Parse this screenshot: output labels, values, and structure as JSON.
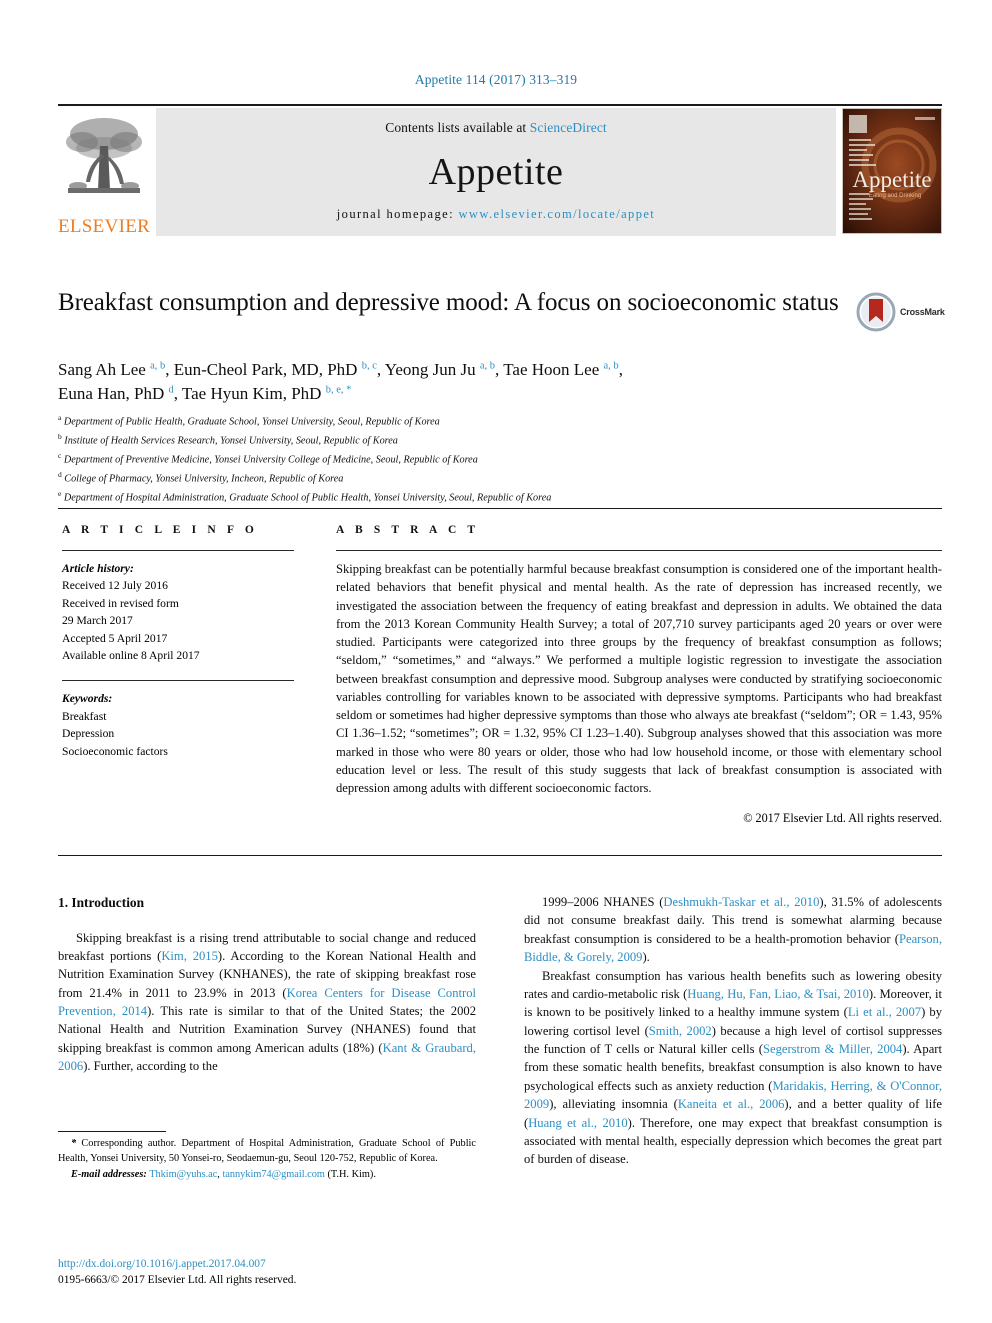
{
  "running_head": "Appetite 114 (2017) 313–319",
  "banner": {
    "publisher": "ELSEVIER",
    "contents_prefix": "Contents lists available at ",
    "contents_link": "ScienceDirect",
    "journal_name": "Appetite",
    "homepage_prefix": "journal homepage: ",
    "homepage_url": "www.elsevier.com/locate/appet",
    "cover_title": "Appetite",
    "cover_subtitle": "Eating and Drinking"
  },
  "article": {
    "title": "Breakfast consumption and depressive mood: A focus on socioeconomic status",
    "crossmark_label": "CrossMark",
    "authors_line1": "Sang Ah Lee <sup>a, b</sup>, Eun-Cheol Park, MD, PhD <sup>b, c</sup>, Yeong Jun Ju <sup>a, b</sup>, Tae Hoon Lee <sup>a, b</sup>,",
    "authors_line2": "Euna Han, PhD <sup>d</sup>, Tae Hyun Kim, PhD <sup>b, e, *</sup>",
    "affiliations": [
      {
        "marker": "a",
        "text": "Department of Public Health, Graduate School, Yonsei University, Seoul, Republic of Korea"
      },
      {
        "marker": "b",
        "text": "Institute of Health Services Research, Yonsei University, Seoul, Republic of Korea"
      },
      {
        "marker": "c",
        "text": "Department of Preventive Medicine, Yonsei University College of Medicine, Seoul, Republic of Korea"
      },
      {
        "marker": "d",
        "text": "College of Pharmacy, Yonsei University, Incheon, Republic of Korea"
      },
      {
        "marker": "e",
        "text": "Department of Hospital Administration, Graduate School of Public Health, Yonsei University, Seoul, Republic of Korea"
      }
    ]
  },
  "article_info": {
    "heading": "A R T I C L E  I N F O",
    "history_label": "Article history:",
    "history": [
      "Received 12 July 2016",
      "Received in revised form",
      "29 March 2017",
      "Accepted 5 April 2017",
      "Available online 8 April 2017"
    ],
    "keywords_label": "Keywords:",
    "keywords": [
      "Breakfast",
      "Depression",
      "Socioeconomic factors"
    ]
  },
  "abstract": {
    "heading": "A B S T R A C T",
    "text": "Skipping breakfast can be potentially harmful because breakfast consumption is considered one of the important health-related behaviors that benefit physical and mental health. As the rate of depression has increased recently, we investigated the association between the frequency of eating breakfast and depression in adults. We obtained the data from the 2013 Korean Community Health Survey; a total of 207,710 survey participants aged 20 years or over were studied. Participants were categorized into three groups by the frequency of breakfast consumption as follows; “seldom,” “sometimes,” and “always.” We performed a multiple logistic regression to investigate the association between breakfast consumption and depressive mood. Subgroup analyses were conducted by stratifying socioeconomic variables controlling for variables known to be associated with depressive symptoms. Participants who had breakfast seldom or sometimes had higher depressive symptoms than those who always ate breakfast (“seldom”; OR = 1.43, 95% CI 1.36–1.52; “sometimes”; OR = 1.32, 95% CI 1.23–1.40). Subgroup analyses showed that this association was more marked in those who were 80 years or older, those who had low household income, or those with elementary school education level or less. The result of this study suggests that lack of breakfast consumption is associated with depression among adults with different socioeconomic factors.",
    "copyright": "© 2017 Elsevier Ltd. All rights reserved."
  },
  "introduction": {
    "section_title": "1.  Introduction",
    "left_paragraph": "Skipping breakfast is a rising trend attributable to social change and reduced breakfast portions (<span class=\"cite\">Kim, 2015</span>). According to the Korean National Health and Nutrition Examination Survey (KNHANES), the rate of skipping breakfast rose from 21.4% in 2011 to 23.9% in 2013 (<span class=\"cite\">Korea Centers for Disease Control Prevention, 2014</span>). This rate is similar to that of the United States; the 2002 National Health and Nutrition Examination Survey (NHANES) found that skipping breakfast is common among American adults (18%) (<span class=\"cite\">Kant &amp; Graubard, 2006</span>). Further, according to the",
    "right_paragraph_1": "1999–2006 NHANES (<span class=\"cite\">Deshmukh-Taskar et al., 2010</span>), 31.5% of adolescents did not consume breakfast daily. This trend is somewhat alarming because breakfast consumption is considered to be a health-promotion behavior (<span class=\"cite\">Pearson, Biddle, &amp; Gorely, 2009</span>).",
    "right_paragraph_2": "Breakfast consumption has various health benefits such as lowering obesity rates and cardio-metabolic risk (<span class=\"cite\">Huang, Hu, Fan, Liao, &amp; Tsai, 2010</span>). Moreover, it is known to be positively linked to a healthy immune system (<span class=\"cite\">Li et al., 2007</span>) by lowering cortisol level (<span class=\"cite\">Smith, 2002</span>) because a high level of cortisol suppresses the function of T cells or Natural killer cells (<span class=\"cite\">Segerstrom &amp; Miller, 2004</span>). Apart from these somatic health benefits, breakfast consumption is also known to have psychological effects such as anxiety reduction (<span class=\"cite\">Maridakis, Herring, &amp; O'Connor, 2009</span>), alleviating insomnia (<span class=\"cite\">Kaneita et al., 2006</span>), and a better quality of life (<span class=\"cite\">Huang et al., 2010</span>). Therefore, one may expect that breakfast consumption is associated with mental health, especially depression which becomes the great part of burden of disease."
  },
  "footnotes": {
    "corresponding": "<span class=\"em\">*</span> Corresponding author. Department of Hospital Administration, Graduate School of Public Health, Yonsei University, 50 Yonsei-ro, Seodaemun-gu, Seoul 120-752, Republic of Korea.",
    "email_label": "E-mail addresses:",
    "email_1": "Thkim@yuhs.ac",
    "email_2": "tannykim74@gmail.com",
    "email_suffix": "(T.H. Kim)."
  },
  "doi": {
    "url": "http://dx.doi.org/10.1016/j.appet.2017.04.007",
    "issn_line": "0195-6663/© 2017 Elsevier Ltd. All rights reserved."
  },
  "colors": {
    "link": "#2b8fc4",
    "elsevier_orange": "#ED7D23",
    "banner_bg": "#e7e7e7"
  }
}
